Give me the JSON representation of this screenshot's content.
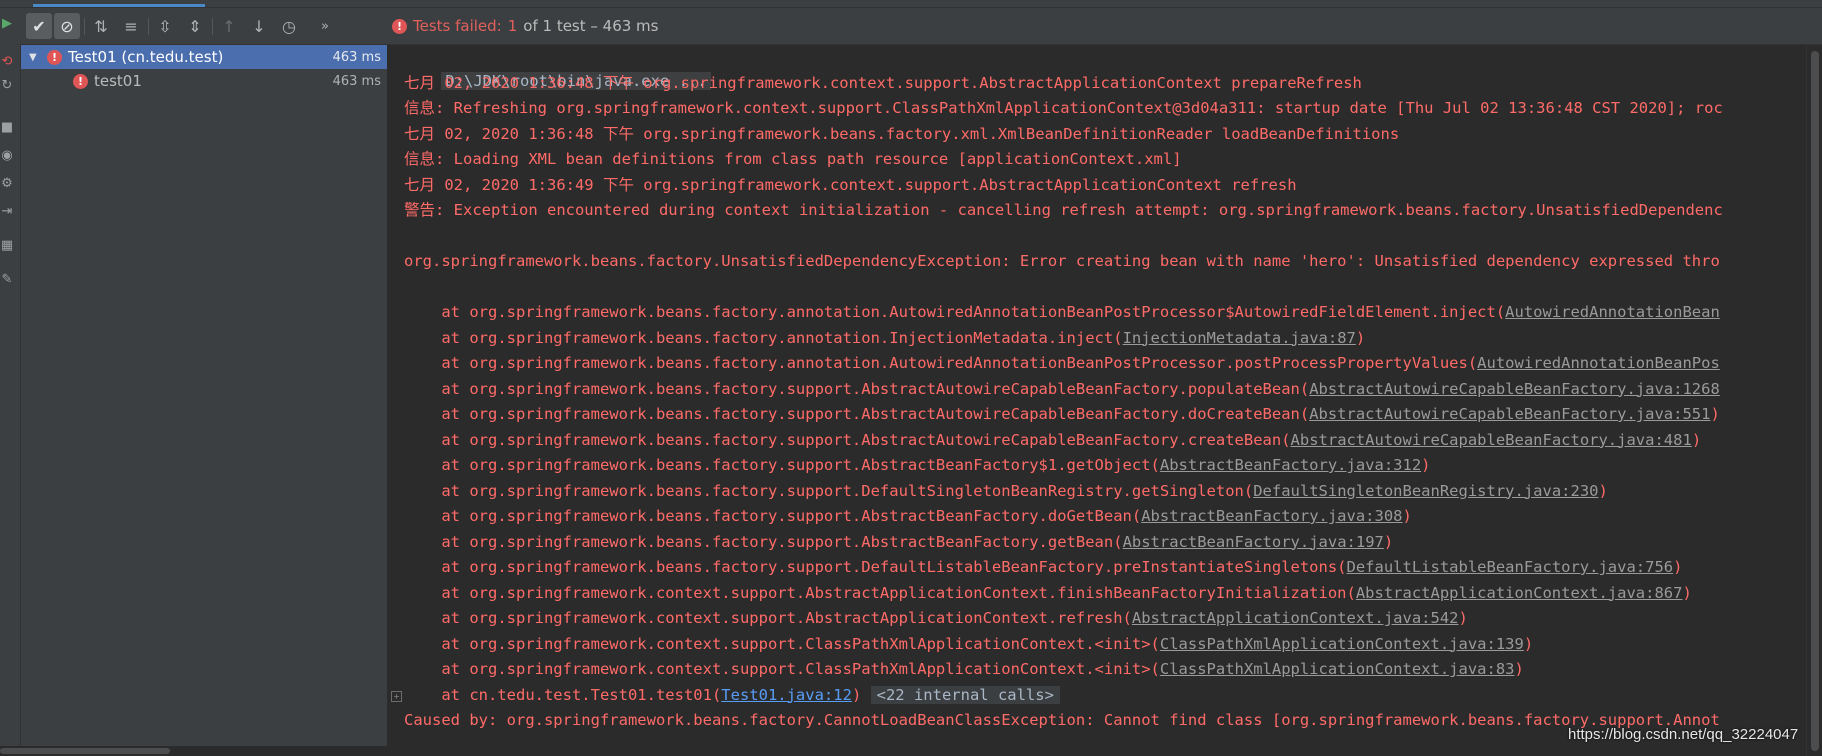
{
  "toolbar": {
    "tooltip_run": "run",
    "status_prefix": "Tests failed:",
    "failed_count": "1",
    "status_suffix": "of 1 test – 463 ms"
  },
  "tree": {
    "items": [
      {
        "label": "Test01 (cn.tedu.test)",
        "time": "463 ms"
      },
      {
        "label": "test01",
        "time": "463 ms"
      }
    ]
  },
  "console": {
    "command": "D:\\JDK\\root\\bin\\java.exe ...",
    "lines": [
      "七月 02, 2020 1:36:48 下午 org.springframework.context.support.AbstractApplicationContext prepareRefresh",
      "信息: Refreshing org.springframework.context.support.ClassPathXmlApplicationContext@3d04a311: startup date [Thu Jul 02 13:36:48 CST 2020]; roc",
      "七月 02, 2020 1:36:48 下午 org.springframework.beans.factory.xml.XmlBeanDefinitionReader loadBeanDefinitions",
      "信息: Loading XML bean definitions from class path resource [applicationContext.xml]",
      "七月 02, 2020 1:36:49 下午 org.springframework.context.support.AbstractApplicationContext refresh",
      "警告: Exception encountered during context initialization - cancelling refresh attempt: org.springframework.beans.factory.UnsatisfiedDependenc",
      "",
      "org.springframework.beans.factory.UnsatisfiedDependencyException: Error creating bean with name 'hero': Unsatisfied dependency expressed thro"
    ],
    "stack": [
      {
        "text": "    at org.springframework.beans.factory.annotation.AutowiredAnnotationBeanPostProcessor$AutowiredFieldElement.inject(",
        "link": "AutowiredAnnotationBean",
        "close": ""
      },
      {
        "text": "    at org.springframework.beans.factory.annotation.InjectionMetadata.inject(",
        "link": "InjectionMetadata.java:87",
        "close": ")"
      },
      {
        "text": "    at org.springframework.beans.factory.annotation.AutowiredAnnotationBeanPostProcessor.postProcessPropertyValues(",
        "link": "AutowiredAnnotationBeanPos",
        "close": ""
      },
      {
        "text": "    at org.springframework.beans.factory.support.AbstractAutowireCapableBeanFactory.populateBean(",
        "link": "AbstractAutowireCapableBeanFactory.java:1268",
        "close": ""
      },
      {
        "text": "    at org.springframework.beans.factory.support.AbstractAutowireCapableBeanFactory.doCreateBean(",
        "link": "AbstractAutowireCapableBeanFactory.java:551",
        "close": ")"
      },
      {
        "text": "    at org.springframework.beans.factory.support.AbstractAutowireCapableBeanFactory.createBean(",
        "link": "AbstractAutowireCapableBeanFactory.java:481",
        "close": ")"
      },
      {
        "text": "    at org.springframework.beans.factory.support.AbstractBeanFactory$1.getObject(",
        "link": "AbstractBeanFactory.java:312",
        "close": ")"
      },
      {
        "text": "    at org.springframework.beans.factory.support.DefaultSingletonBeanRegistry.getSingleton(",
        "link": "DefaultSingletonBeanRegistry.java:230",
        "close": ")"
      },
      {
        "text": "    at org.springframework.beans.factory.support.AbstractBeanFactory.doGetBean(",
        "link": "AbstractBeanFactory.java:308",
        "close": ")"
      },
      {
        "text": "    at org.springframework.beans.factory.support.AbstractBeanFactory.getBean(",
        "link": "AbstractBeanFactory.java:197",
        "close": ")"
      },
      {
        "text": "    at org.springframework.beans.factory.support.DefaultListableBeanFactory.preInstantiateSingletons(",
        "link": "DefaultListableBeanFactory.java:756",
        "close": ")"
      },
      {
        "text": "    at org.springframework.context.support.AbstractApplicationContext.finishBeanFactoryInitialization(",
        "link": "AbstractApplicationContext.java:867",
        "close": ")"
      },
      {
        "text": "    at org.springframework.context.support.AbstractApplicationContext.refresh(",
        "link": "AbstractApplicationContext.java:542",
        "close": ")"
      },
      {
        "text": "    at org.springframework.context.support.ClassPathXmlApplicationContext.<init>(",
        "link": "ClassPathXmlApplicationContext.java:139",
        "close": ")"
      },
      {
        "text": "    at org.springframework.context.support.ClassPathXmlApplicationContext.<init>(",
        "link": "ClassPathXmlApplicationContext.java:83",
        "close": ")"
      }
    ],
    "last_frame": {
      "text": "    at cn.tedu.test.Test01.test01(",
      "link": "Test01.java:12",
      "close": ")",
      "internal": "<22 internal calls>"
    },
    "caused_by": "Caused by: org.springframework.beans.factory.CannotLoadBeanClassException: Cannot find class [org.springframework.beans.factory.support.Annot"
  },
  "watermark": "https://blog.csdn.net/qq_32224047",
  "colors": {
    "error": "#ff6b68",
    "selection": "#4b6eaf",
    "link": "#589df6",
    "panel": "#3c3f41",
    "editor": "#2b2b2b"
  }
}
